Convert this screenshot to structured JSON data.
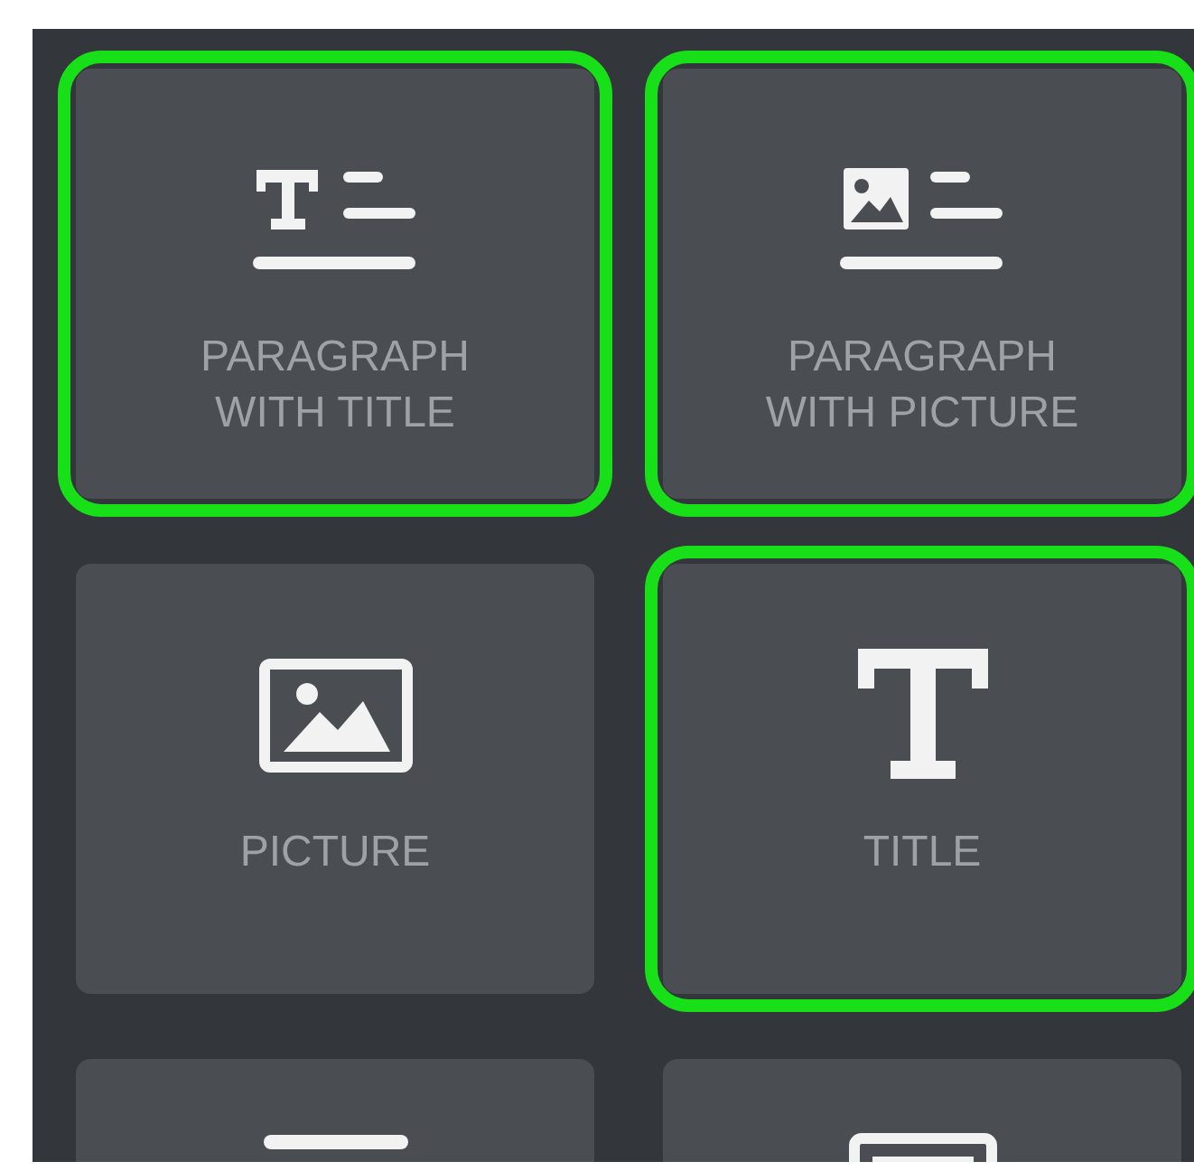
{
  "tiles": [
    {
      "kind": "paragraph_title",
      "label": "PARAGRAPH WITH TITLE",
      "selected": true
    },
    {
      "kind": "paragraph_picture",
      "label": "PARAGRAPH WITH PICTURE",
      "selected": true
    },
    {
      "kind": "picture",
      "label": "PICTURE",
      "selected": false
    },
    {
      "kind": "title",
      "label": "TITLE",
      "selected": true
    },
    {
      "kind": "line",
      "selected": false
    },
    {
      "kind": "frame",
      "selected": false
    }
  ]
}
